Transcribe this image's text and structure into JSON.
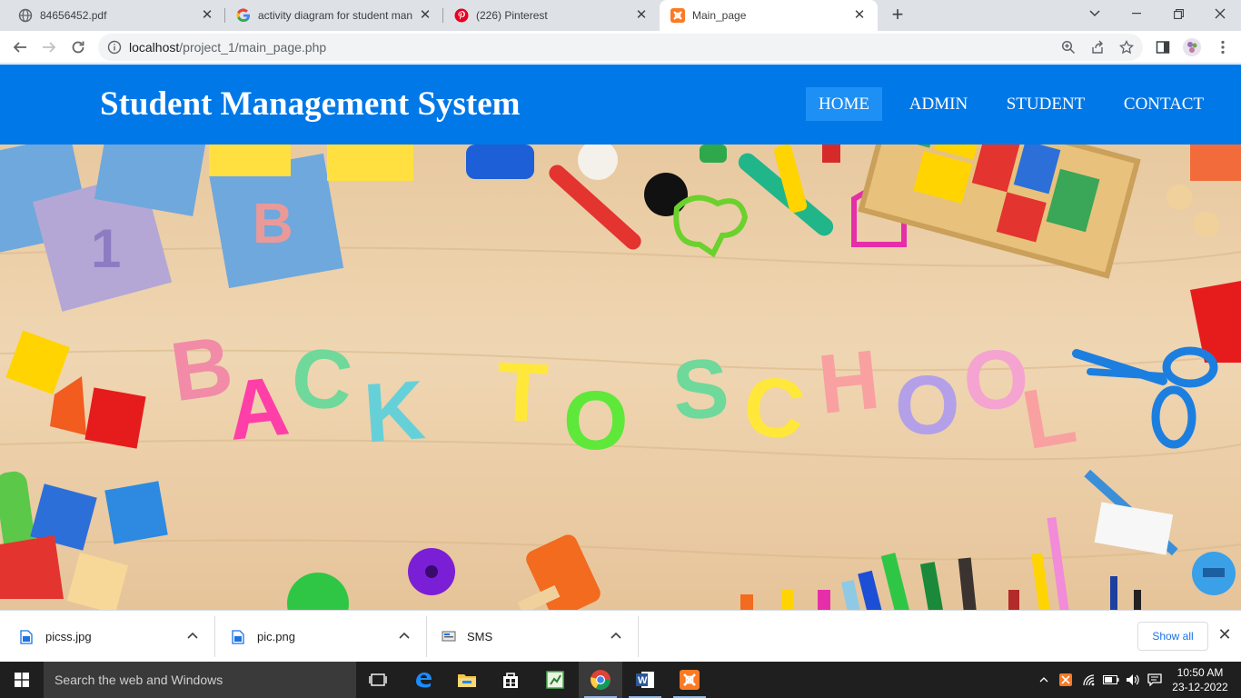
{
  "browser": {
    "tabs": [
      {
        "title": "84656452.pdf",
        "icon": "globe-icon",
        "active": false
      },
      {
        "title": "activity diagram for student management system",
        "icon": "google-icon",
        "active": false
      },
      {
        "title": "(226) Pinterest",
        "icon": "pinterest-icon",
        "active": false
      },
      {
        "title": "Main_page",
        "icon": "xampp-icon",
        "active": true
      }
    ],
    "url_host": "localhost",
    "url_path": "/project_1/main_page.php"
  },
  "site": {
    "title": "Student Management System",
    "header_color": "#0078e8",
    "nav": [
      {
        "label": "HOME",
        "active": true
      },
      {
        "label": "ADMIN",
        "active": false
      },
      {
        "label": "STUDENT",
        "active": false
      },
      {
        "label": "CONTACT",
        "active": false
      }
    ],
    "hero_words": [
      "BACK",
      "TO",
      "SCHOOL"
    ]
  },
  "downloads": {
    "items": [
      {
        "name": "picss.jpg",
        "icon": "image-file-icon"
      },
      {
        "name": "pic.png",
        "icon": "image-file-icon"
      },
      {
        "name": "SMS",
        "icon": "file-icon"
      }
    ],
    "show_all": "Show all"
  },
  "taskbar": {
    "search_placeholder": "Search the web and Windows",
    "time": "10:50 AM",
    "date": "23-12-2022"
  }
}
